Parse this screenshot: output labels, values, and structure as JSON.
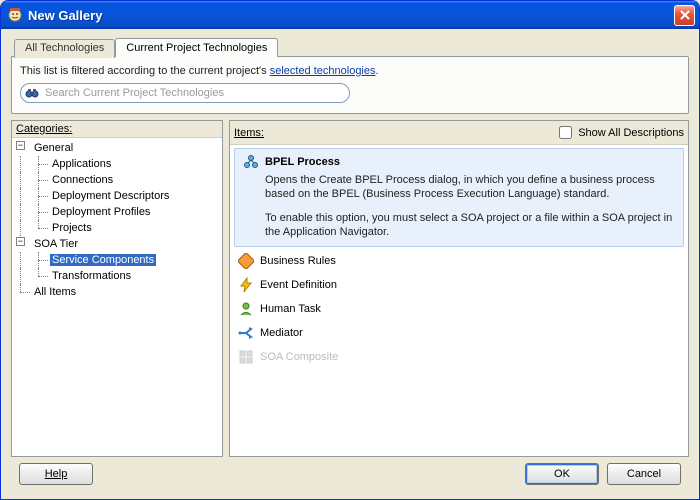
{
  "window": {
    "title": "New Gallery"
  },
  "tabs": {
    "all": "All Technologies",
    "current": "Current Project Technologies"
  },
  "filter": {
    "prefix": "This list is filtered according to the current project's ",
    "link": "selected technologies",
    "suffix": "."
  },
  "search": {
    "placeholder": "Search Current Project Technologies"
  },
  "panels": {
    "categories_label": "Categories:",
    "items_label": "Items:",
    "show_all_label": "Show All Descriptions"
  },
  "tree": {
    "general": "General",
    "general_children": {
      "applications": "Applications",
      "connections": "Connections",
      "deployment_descriptors": "Deployment Descriptors",
      "deployment_profiles": "Deployment Profiles",
      "projects": "Projects"
    },
    "soa_tier": "SOA Tier",
    "soa_children": {
      "service_components": "Service Components",
      "transformations": "Transformations"
    },
    "all_items": "All Items"
  },
  "items": {
    "bpel": {
      "title": "BPEL Process",
      "desc1": "Opens the Create BPEL Process dialog, in which you define a business process based on the BPEL (Business Process Execution Language) standard.",
      "desc2": "To enable this option, you must select a SOA project or a file within a SOA project in the Application Navigator."
    },
    "business_rules": "Business Rules",
    "event_definition": "Event Definition",
    "human_task": "Human Task",
    "mediator": "Mediator",
    "soa_composite": "SOA Composite"
  },
  "buttons": {
    "help": "Help",
    "ok": "OK",
    "cancel": "Cancel"
  }
}
